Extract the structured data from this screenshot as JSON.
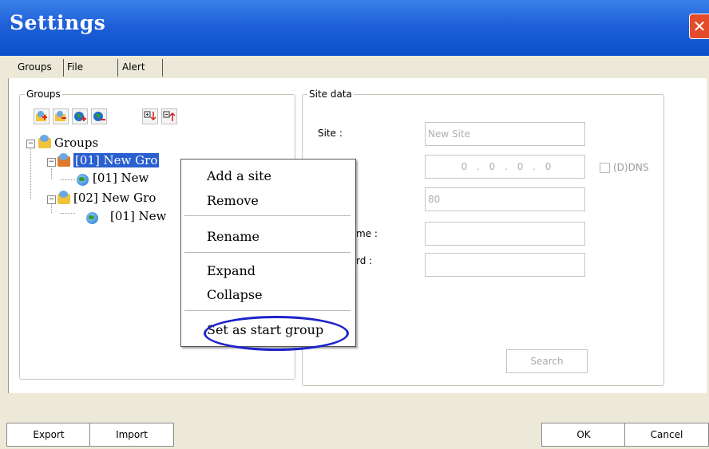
{
  "window": {
    "title": "Settings",
    "close_label": "✕"
  },
  "tabs": [
    "Groups",
    "File path",
    "Alert"
  ],
  "groups_box": {
    "label": "Groups"
  },
  "toolbar_icons": [
    "add-group-icon",
    "remove-group-icon",
    "add-site-icon",
    "remove-site-icon",
    "move-down-icon",
    "move-up-icon"
  ],
  "tree": {
    "root": "Groups",
    "items": [
      {
        "label": "[01] New Gro",
        "level": 1
      },
      {
        "label": "[01] New",
        "level": 2
      },
      {
        "label": "[02] New Gro",
        "level": 1
      },
      {
        "label": "[01] New",
        "level": 2
      }
    ]
  },
  "site_data": {
    "label": "Site data",
    "site_label": "Site :",
    "site_value": "New Site",
    "ip_value": "0 . 0 . 0 . 0",
    "dns_label": "(D)DNS",
    "port_value": "80",
    "username_label": "me :",
    "password_label": "rd :",
    "search_label": "Search"
  },
  "context_menu": {
    "items": [
      "Add a site",
      "Remove",
      "Rename",
      "Expand",
      "Collapse",
      "Set as start group"
    ]
  },
  "footer": {
    "export": "Export",
    "import": "Import",
    "ok": "OK",
    "cancel": "Cancel"
  },
  "colors": {
    "titlebar": "#1f60d8",
    "selection": "#2a5fcf",
    "highlight_oval": "#1d22c8"
  }
}
